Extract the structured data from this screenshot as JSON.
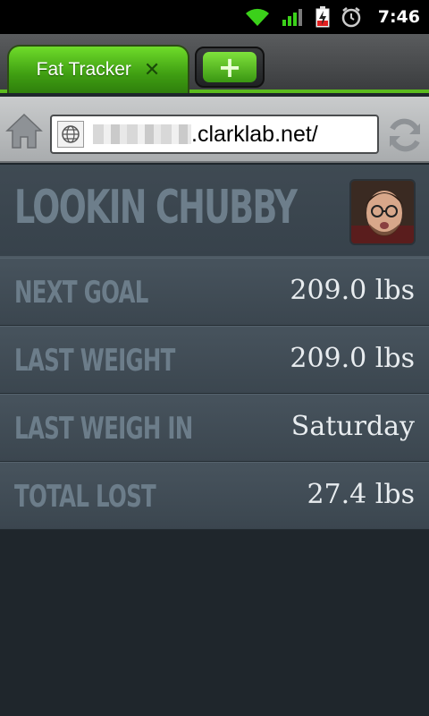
{
  "status_bar": {
    "time": "7:46",
    "icons": [
      "wifi-icon",
      "signal-icon",
      "battery-charging-icon",
      "alarm-icon"
    ]
  },
  "browser": {
    "tab_title": "Fat Tracker",
    "tab_close_glyph": "✕",
    "new_tab_glyph": "+",
    "url_visible": ".clarklab.net/"
  },
  "app": {
    "title": "LOOKIN CHUBBY",
    "stats": [
      {
        "label": "NEXT GOAL",
        "value": "209.0 lbs"
      },
      {
        "label": "LAST WEIGHT",
        "value": "209.0 lbs"
      },
      {
        "label": "LAST WEIGH IN",
        "value": "Saturday"
      },
      {
        "label": "TOTAL LOST",
        "value": "27.4 lbs"
      }
    ]
  },
  "colors": {
    "accent_green": "#5bbb1e",
    "panel_bg": "#3b464f",
    "label_text": "#6c7d8a",
    "value_text": "#e8ecef"
  }
}
